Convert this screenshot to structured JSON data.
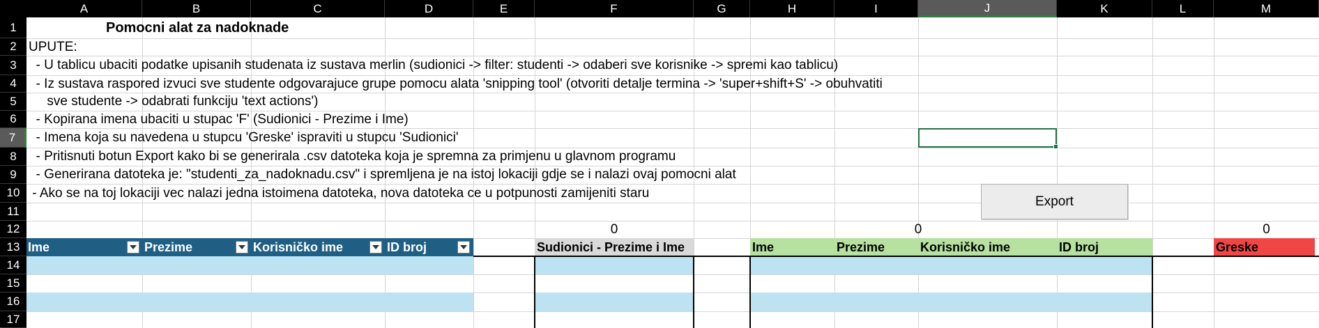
{
  "columns": [
    "A",
    "B",
    "C",
    "D",
    "E",
    "F",
    "G",
    "H",
    "I",
    "J",
    "K",
    "L",
    "M"
  ],
  "rows": [
    "1",
    "2",
    "3",
    "4",
    "5",
    "6",
    "7",
    "8",
    "9",
    "10",
    "11",
    "12",
    "13",
    "14",
    "15",
    "16",
    "17"
  ],
  "selected": {
    "column": "J",
    "row": "7"
  },
  "title": "Pomocni alat za nadoknade",
  "instructions": [
    "UPUTE:",
    "  - U tablicu ubaciti podatke upisanih studenata iz sustava merlin (sudionici -> filter: studenti -> odaberi sve korisnike -> spremi kao tablicu)",
    "  - Iz sustava raspored izvuci sve studente odgovarajuce grupe pomocu alata 'snipping tool' (otvoriti detalje termina -> 'super+shift+S' -> obuhvatiti",
    "     sve studente -> odabrati funkciju 'text actions')",
    "  - Kopirana imena ubaciti u stupac 'F' (Sudionici - Prezime i Ime)",
    "  - Imena koja su navedena u stupcu 'Greske' ispraviti u stupcu 'Sudionici'",
    "  - Pritisnuti botun Export kako bi se generirala .csv datoteka koja je spremna za primjenu u glavnom programu",
    "  - Generirana datoteka je: \"studenti_za_nadoknadu.csv\" i spremljena je na istoj lokaciji gdje se i nalazi ovaj pomocni alat",
    " - Ako se na toj lokaciji vec nalazi jedna istoimena datoteka, nova datoteka ce u potpunosti zamijeniti staru"
  ],
  "export_button": "Export",
  "counts": {
    "f": "0",
    "j": "0",
    "m": "0"
  },
  "table_students": {
    "headers": [
      "Ime",
      "Prezime",
      "Korisničko ime",
      "ID broj"
    ]
  },
  "table_participants": {
    "header": "Sudionici - Prezime i Ime"
  },
  "table_matched": {
    "headers": [
      "Ime",
      "Prezime",
      "Korisničko ime",
      "ID broj"
    ]
  },
  "table_errors": {
    "header": "Greske"
  },
  "colors": {
    "student_header": "#1f5f84",
    "matched_header": "#b7e1a1",
    "error_header": "#f04646",
    "band": "#bde3f2"
  }
}
